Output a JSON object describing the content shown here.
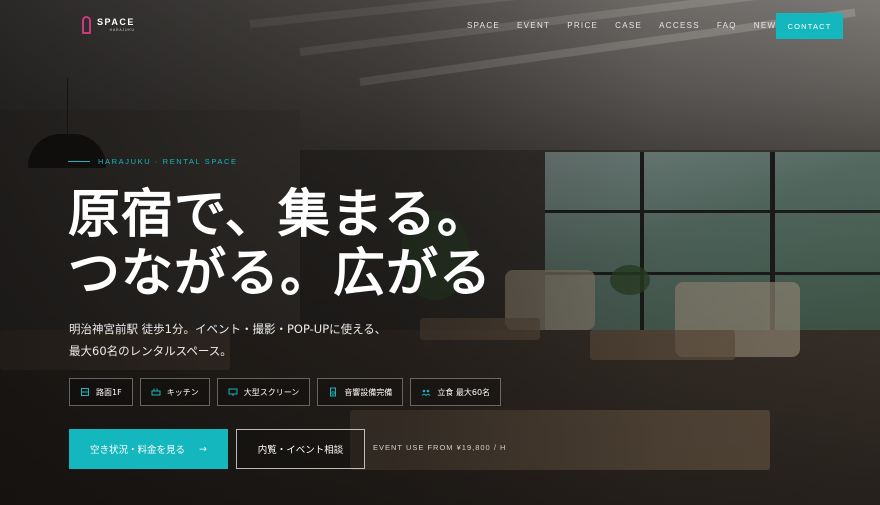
{
  "header": {
    "logo": {
      "name": "SPACE",
      "sub": "HARAJUKU"
    },
    "nav": [
      "SPACE",
      "EVENT",
      "PRICE",
      "CASE",
      "ACCESS",
      "FAQ",
      "NEWS"
    ],
    "contact_label": "CONTACT"
  },
  "hero": {
    "eyebrow": "HARAJUKU · RENTAL SPACE",
    "headline_line1": "原宿で、集まる。",
    "headline_line2": "つながる。広がる",
    "desc_line1": "明治神宮前駅 徒歩1分。イベント・撮影・POP-UPに使える、",
    "desc_line2": "最大60名のレンタルスペース。",
    "features": [
      {
        "label": "路面1F",
        "icon": "building-icon"
      },
      {
        "label": "キッチン",
        "icon": "kitchen-icon"
      },
      {
        "label": "大型スクリーン",
        "icon": "screen-icon"
      },
      {
        "label": "音響設備完備",
        "icon": "speaker-icon"
      },
      {
        "label": "立食 最大60名",
        "icon": "people-icon"
      }
    ],
    "cta_primary": "空き状況・料金を見る",
    "cta_primary_arrow": "→",
    "cta_secondary": "内覧・イベント相談",
    "price_note": "EVENT USE FROM ¥19,800 / H"
  },
  "colors": {
    "accent": "#14b7bd",
    "logo": "#c93b7b"
  }
}
